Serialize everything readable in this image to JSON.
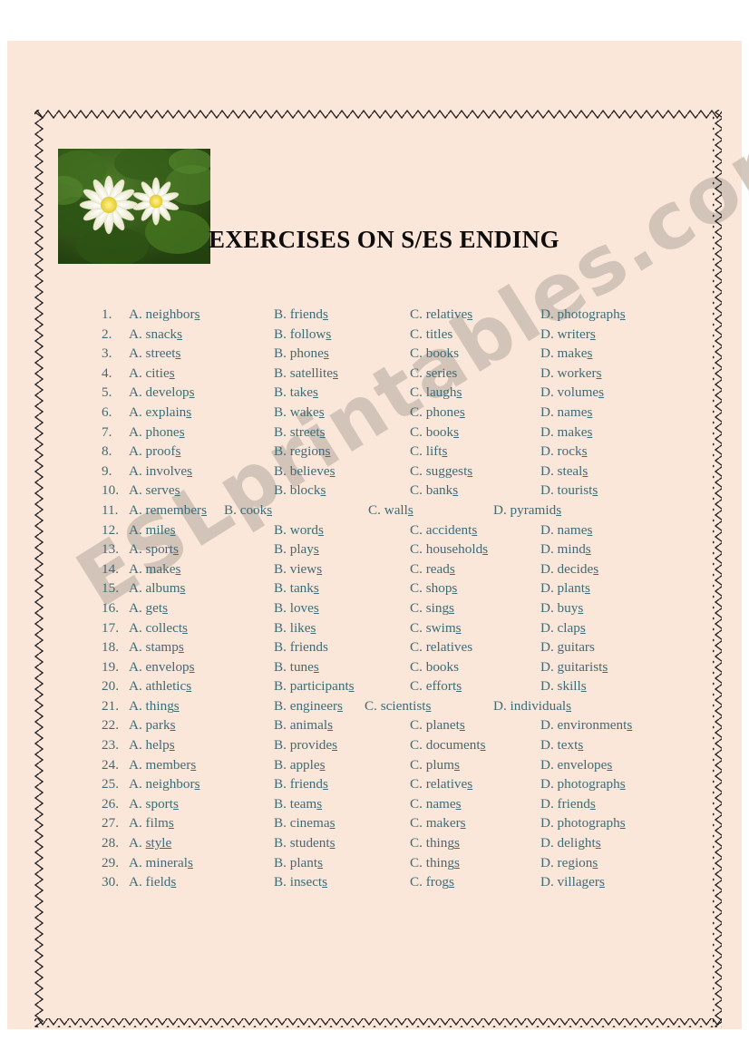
{
  "page": {
    "background_color": "#fbe7da",
    "canvas_color": "#ffffff",
    "frame_color": "#231f20",
    "text_color": "#3c6b76",
    "title_color": "#0d0d0d"
  },
  "watermark": {
    "text": "ESLprintables.com",
    "color": "#cbbfb3"
  },
  "header": {
    "title": "EXERCISES ON  S/ES ENDING",
    "image": {
      "name": "water-lilies-photo",
      "alt": "Two yellow-white water lilies on green lily pads"
    }
  },
  "questions": [
    {
      "num": "1.",
      "layout": "wide",
      "a": "A. neighbor|s",
      "b": "B. friend|s",
      "c": "C. relative|s",
      "d": "D. photograph|s"
    },
    {
      "num": "2.",
      "layout": "wide",
      "a": "A. snack|s",
      "b": "B. follow|s",
      "c": "C. titles",
      "d": "D. writer|s"
    },
    {
      "num": "3.",
      "layout": "wide",
      "a": "A. street|s",
      "b": "B. phone|s",
      "c": "C. books",
      "d": "D. make|s"
    },
    {
      "num": "4.",
      "layout": "wide",
      "a": "A. citie|s",
      "b": "B. satellite|s",
      "c": "C. series",
      "d": "D. worker|s"
    },
    {
      "num": "5.",
      "layout": "wide",
      "a": "A. develop|s",
      "b": "B. take|s",
      "c": "C. laugh|s",
      "d": "D. volume|s"
    },
    {
      "num": "6.",
      "layout": "wide",
      "a": "A. explain|s",
      "b": "B. wake|s",
      "c": "C. phone|s",
      "d": "D. name|s"
    },
    {
      "num": "7.",
      "layout": "wide",
      "a": "A. phone|s",
      "b": "B. street|s",
      "c": "C. book|s",
      "d": "D. make|s"
    },
    {
      "num": "8.",
      "layout": "wide",
      "a": "A. proof|s",
      "b": "B. region|s",
      "c": "C. lift|s",
      "d": "D. rock|s"
    },
    {
      "num": "9.",
      "layout": "wide",
      "a": "A. involve|s",
      "b": "B. believe|s",
      "c": "C. suggest|s",
      "d": "D. steal|s"
    },
    {
      "num": "10.",
      "layout": "wide",
      "a": "A. serve|s",
      "b": "B. block|s",
      "c": "C. bank|s",
      "d": "D. tourist|s"
    },
    {
      "num": "11.",
      "layout": "alt",
      "a": "A. remember|s",
      "b": "B. cook|s",
      "c": "C. wall|s",
      "d": "D. pyramid|s"
    },
    {
      "num": "12.",
      "layout": "wide",
      "a": "A. mile|s",
      "b": "B. word|s",
      "c": "C. accident|s",
      "d": "D. name|s"
    },
    {
      "num": "13.",
      "layout": "wide",
      "a": "A. sport|s",
      "b": "B. play|s",
      "c": "C. household|s",
      "d": "D. mind|s"
    },
    {
      "num": "14.",
      "layout": "wide",
      "a": "A. make|s",
      "b": "B. view|s",
      "c": "C. read|s",
      "d": "D. decide|s"
    },
    {
      "num": "15.",
      "layout": "wide",
      "a": "A. album|s",
      "b": "B. tank|s",
      "c": "C. shop|s",
      "d": "D. plant|s"
    },
    {
      "num": "16.",
      "layout": "wide",
      "a": "A. get|s",
      "b": "B. love|s",
      "c": "C. sing|s",
      "d": "D. buy|s"
    },
    {
      "num": "17.",
      "layout": "wide",
      "a": "A. collect|s",
      "b": "B. like|s",
      "c": "C. swim|s",
      "d": "D. clap|s"
    },
    {
      "num": "18.",
      "layout": "wide",
      "a": "A. stamp|s",
      "b": "B. friends",
      "c": "C. relatives",
      "d": "D. guitars"
    },
    {
      "num": "19.",
      "layout": "wide",
      "a": "A. envelop|s",
      "b": "B. tune|s",
      "c": "C. books",
      "d": "D. guitarist|s"
    },
    {
      "num": "20.",
      "layout": "wide",
      "a": "A. athletic|s",
      "b": "B. participant|s",
      "c": "C. effort|s",
      "d": "D. skill|s"
    },
    {
      "num": "21.",
      "layout": "alt2",
      "a": "A. thing|s",
      "b": "B. engineer|s",
      "c": "C. scientist|s",
      "d": "D. individual|s"
    },
    {
      "num": "22.",
      "layout": "wide",
      "a": "A. park|s",
      "b": "B. animal|s",
      "c": "C. planet|s",
      "d": "D. environment|s"
    },
    {
      "num": "23.",
      "layout": "wide",
      "a": "A. help|s",
      "b": "B. provide|s",
      "c": "C. document|s",
      "d": "D. text|s"
    },
    {
      "num": "24.",
      "layout": "wide",
      "a": "A. member|s",
      "b": "B. apple|s",
      "c": "C. plum|s",
      "d": "D. envelope|s"
    },
    {
      "num": "25.",
      "layout": "wide",
      "a": "A. neighbor|s",
      "b": "B. friend|s",
      "c": "C. relative|s",
      "d": "D. photograph|s"
    },
    {
      "num": "26.",
      "layout": "wide",
      "a": "A. sport|s",
      "b": "B. team|s",
      "c": "C. name|s",
      "d": "D. friend|s"
    },
    {
      "num": "27.",
      "layout": "wide",
      "a": "A. film|s",
      "b": "B. cinema|s",
      "c": "C. maker|s",
      "d": "D. photograph|s"
    },
    {
      "num": "28.",
      "layout": "wide",
      "a": "A. |style",
      "b": "B. student|s",
      "c": "C. thing|s",
      "d": "D. delight|s"
    },
    {
      "num": "29.",
      "layout": "wide",
      "a": "A. mineral|s",
      "b": "B. plant|s",
      "c": "C. thing|s",
      "d": "D. region|s"
    },
    {
      "num": "30.",
      "layout": "wide",
      "a": "A. field|s",
      "b": "B. insect|s",
      "c": "C. frog|s",
      "d": "D. villager|s"
    }
  ]
}
